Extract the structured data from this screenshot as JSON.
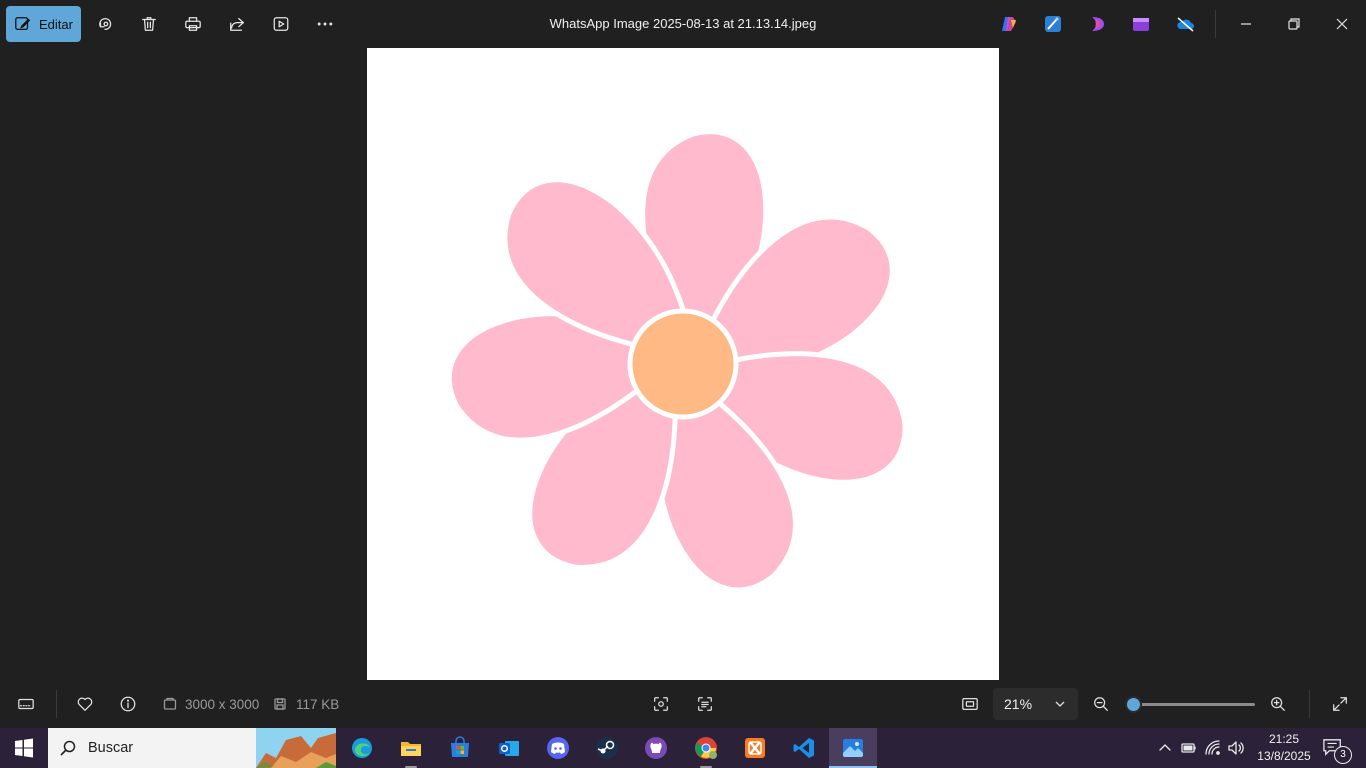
{
  "toolbar": {
    "edit_label": "Editar",
    "icons": [
      "rotate-icon",
      "delete-icon",
      "print-icon",
      "share-icon",
      "slideshow-icon",
      "more-icon"
    ]
  },
  "window": {
    "title": "WhatsApp Image 2025-08-13 at 21.13.14.jpeg",
    "app_icons": [
      "copilot-icon",
      "designer-icon",
      "clipchamp-icon",
      "video-editor-icon",
      "onedrive-off-icon"
    ]
  },
  "image": {
    "description_colors": {
      "petal": "#ffbacd",
      "center": "#ffb985",
      "background": "#ffffff"
    }
  },
  "statusbar": {
    "dimensions": "3000 x 3000",
    "file_size": "117 KB",
    "zoom": "21%",
    "zoom_fraction": 0.05
  },
  "taskbar": {
    "search_placeholder": "Buscar",
    "apps": [
      "edge-icon",
      "file-explorer-icon",
      "microsoft-store-icon",
      "outlook-icon",
      "discord-icon",
      "steam-icon",
      "github-desktop-icon",
      "chrome-icon",
      "xampp-icon",
      "vscode-icon",
      "photos-icon"
    ],
    "time": "21:25",
    "date": "13/8/2025",
    "notifications": "3"
  },
  "colors": {
    "accent": "#5fa7d9",
    "background": "#202020",
    "taskbar": "#2b2138"
  }
}
